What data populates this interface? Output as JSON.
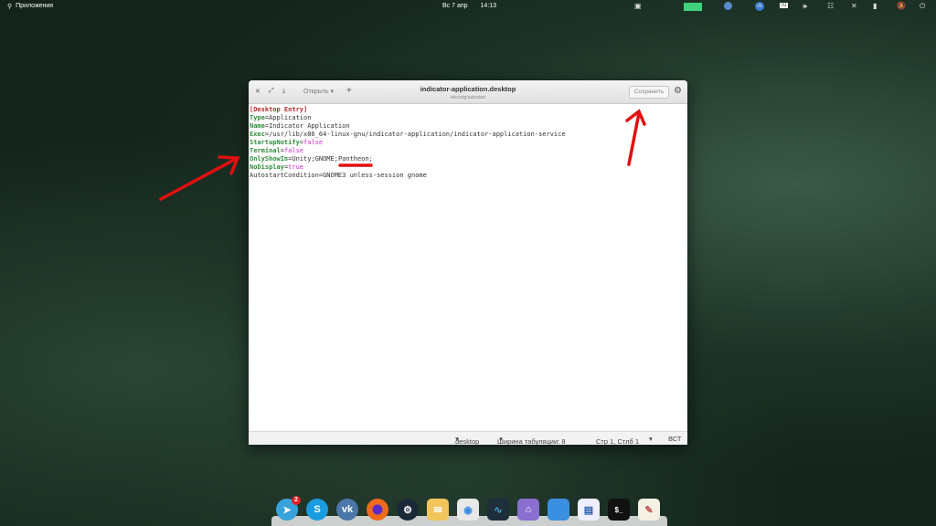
{
  "topbar": {
    "apps_label": "Приложения",
    "date": "Вс 7 апр",
    "time": "14:13",
    "keyboard_layout": "ru"
  },
  "editor": {
    "title": "indicator-application.desktop",
    "path": "/etc/xdg/autostart",
    "open_label": "Открыть",
    "save_label": "Сохранить",
    "lines": [
      {
        "parts": [
          {
            "t": "[Desktop Entry]",
            "c": "s"
          }
        ]
      },
      {
        "parts": [
          {
            "t": "Type",
            "c": "k"
          },
          {
            "t": "=Application",
            "c": ""
          }
        ]
      },
      {
        "parts": [
          {
            "t": "Name",
            "c": "k"
          },
          {
            "t": "=Indicator Application",
            "c": ""
          }
        ]
      },
      {
        "parts": [
          {
            "t": "Exec",
            "c": "k"
          },
          {
            "t": "=/usr/lib/x86_64-linux-gnu/indicator-application/indicator-application-service",
            "c": ""
          }
        ]
      },
      {
        "parts": [
          {
            "t": "StartupNotify",
            "c": "k"
          },
          {
            "t": "=",
            "c": ""
          },
          {
            "t": "false",
            "c": "v"
          }
        ]
      },
      {
        "parts": [
          {
            "t": "Terminal",
            "c": "k"
          },
          {
            "t": "=",
            "c": ""
          },
          {
            "t": "false",
            "c": "v"
          }
        ]
      },
      {
        "parts": [
          {
            "t": "OnlyShowIn",
            "c": "k"
          },
          {
            "t": "=Unity;GNOME;Pantheon;",
            "c": ""
          }
        ]
      },
      {
        "parts": [
          {
            "t": "NoDisplay",
            "c": "k"
          },
          {
            "t": "=",
            "c": ""
          },
          {
            "t": "true",
            "c": "v"
          }
        ]
      },
      {
        "parts": [
          {
            "t": "AutostartCondition=GNOME3 unless-session gnome",
            "c": ""
          }
        ]
      }
    ],
    "status": {
      "language": ".desktop",
      "tab_width": "Ширина табуляции: 8",
      "position": "Стр 1, Стлб 1",
      "insert_mode": "ВСТ"
    }
  },
  "dock": {
    "telegram_badge": "2",
    "terminal_label": "$_"
  },
  "colors": {
    "annotation": "#e01010",
    "window_bg": "#ffffff"
  }
}
